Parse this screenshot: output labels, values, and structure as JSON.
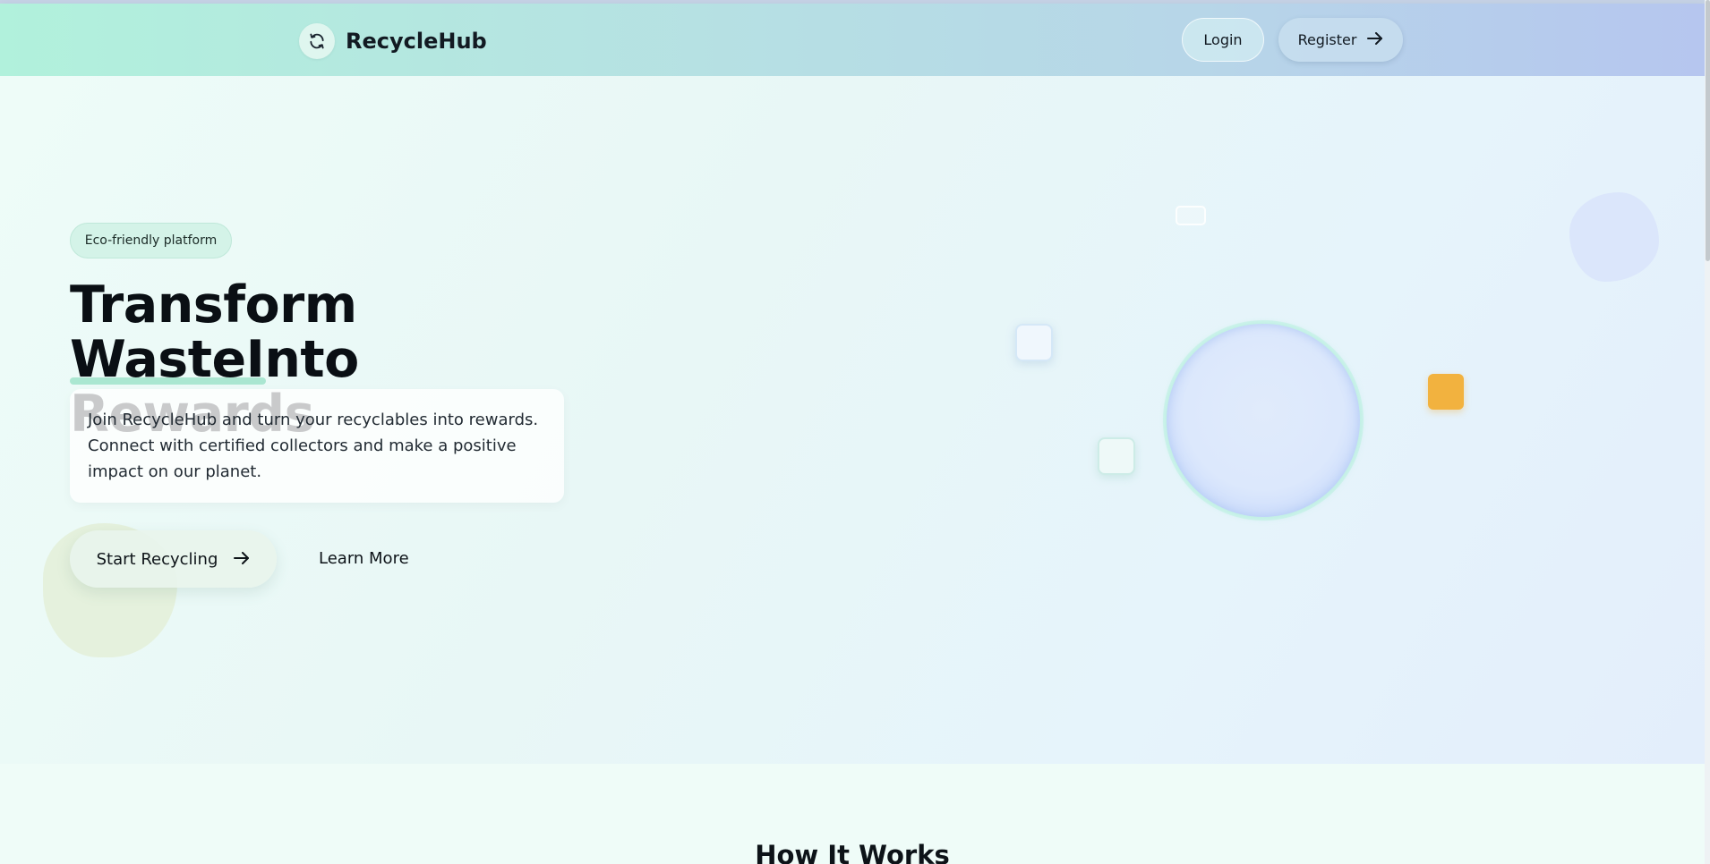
{
  "header": {
    "brand_name": "RecycleHub",
    "login_label": "Login",
    "register_label": "Register"
  },
  "hero": {
    "badge": "Eco-friendly platform",
    "title": "Transform WasteInto Rewards",
    "description": "Join RecycleHub and turn your recyclables into rewards. Connect with certified collectors and make a positive impact on our planet.",
    "start_label": "Start Recycling",
    "learn_more_label": "Learn More"
  },
  "section": {
    "title": "How It Works"
  },
  "colors": {
    "accent_orange": "#f2b23f",
    "accent_green": "#9fe3ca",
    "text_dark": "#0a0f14"
  },
  "icons": {
    "brand": "recycle-icon",
    "arrow": "arrow-right-icon"
  }
}
